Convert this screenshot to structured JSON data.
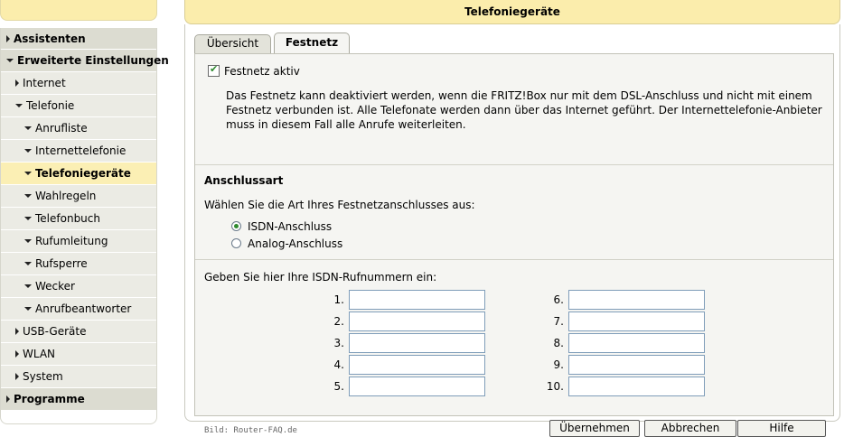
{
  "sidebar": {
    "items": [
      {
        "label": "Assistenten"
      },
      {
        "label": "Erweiterte Einstellungen"
      },
      {
        "label": "Internet"
      },
      {
        "label": "Telefonie"
      },
      {
        "label": "Anrufliste"
      },
      {
        "label": "Internettelefonie"
      },
      {
        "label": "Telefoniegeräte"
      },
      {
        "label": "Wahlregeln"
      },
      {
        "label": "Telefonbuch"
      },
      {
        "label": "Rufumleitung"
      },
      {
        "label": "Rufsperre"
      },
      {
        "label": "Wecker"
      },
      {
        "label": "Anrufbeantworter"
      },
      {
        "label": "USB-Geräte"
      },
      {
        "label": "WLAN"
      },
      {
        "label": "System"
      },
      {
        "label": "Programme"
      }
    ]
  },
  "main": {
    "title": "Telefoniegeräte",
    "tabs": [
      {
        "label": "Übersicht"
      },
      {
        "label": "Festnetz"
      }
    ],
    "festnetz": {
      "checkbox_label": "Festnetz aktiv",
      "checked": true,
      "description": "Das Festnetz kann deaktiviert werden, wenn die FRITZ!Box nur mit dem DSL-Anschluss und nicht mit einem Festnetz verbunden ist. Alle Telefonate werden dann über das Internet geführt. Der Internettelefonie-Anbieter muss in diesem Fall alle Anrufe weiterleiten."
    },
    "anschlussart": {
      "title": "Anschlussart",
      "prompt": "Wählen Sie die Art Ihres Festnetzanschlusses aus:",
      "options": [
        "ISDN-Anschluss",
        "Analog-Anschluss"
      ],
      "selected": "ISDN-Anschluss"
    },
    "isdn": {
      "prompt": "Geben Sie hier Ihre ISDN-Rufnummern ein:",
      "labels": [
        "1.",
        "2.",
        "3.",
        "4.",
        "5.",
        "6.",
        "7.",
        "8.",
        "9.",
        "10."
      ],
      "values": [
        "",
        "",
        "",
        "",
        "",
        "",
        "",
        "",
        "",
        ""
      ]
    },
    "credit": "Bild: Router-FAQ.de",
    "buttons": {
      "apply": "Übernehmen",
      "cancel": "Abbrechen",
      "help": "Hilfe"
    }
  },
  "colors": {
    "header_bg": "#fbedac",
    "active_item_bg": "#fbefb4",
    "sidebar_section_bg": "#dcdcd1",
    "sidebar_item_bg": "#ebebe4",
    "content_bg": "#f5f5f2",
    "check_green": "#2f8a2f"
  }
}
